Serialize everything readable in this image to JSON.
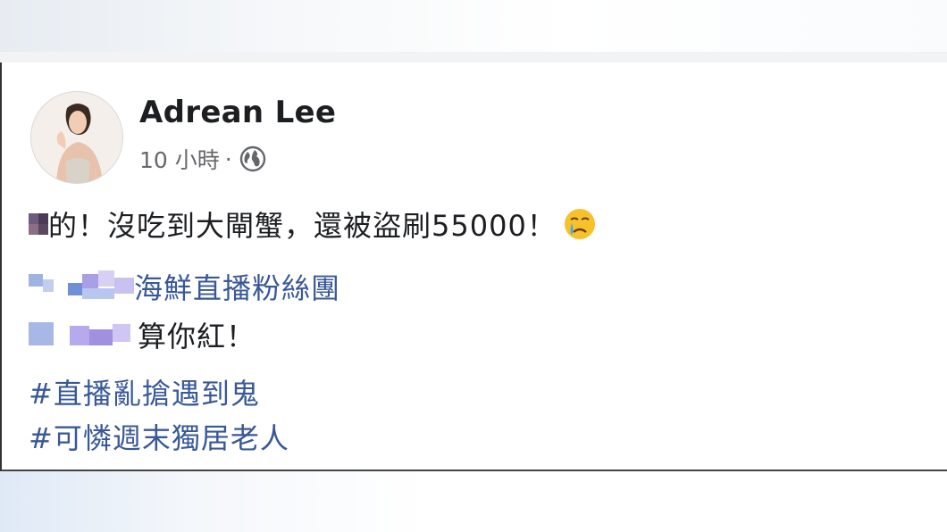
{
  "post": {
    "author": "Adrean Lee",
    "timestamp": "10 小時",
    "separator": "·",
    "privacy_icon": "globe-icon",
    "body_line1": "的！沒吃到大閘蟹，還被盜刷55000！",
    "line1_emoji": "crying-face-emoji-icon",
    "mention_line": "海鮮直播粉絲團",
    "body_line3": "算你紅！",
    "hashtags": [
      "#直播亂搶遇到鬼",
      "#可憐週末獨居老人"
    ]
  },
  "colors": {
    "link": "#385898",
    "text": "#1c1e21",
    "meta": "#65676b",
    "card_bg": "#ffffff"
  }
}
